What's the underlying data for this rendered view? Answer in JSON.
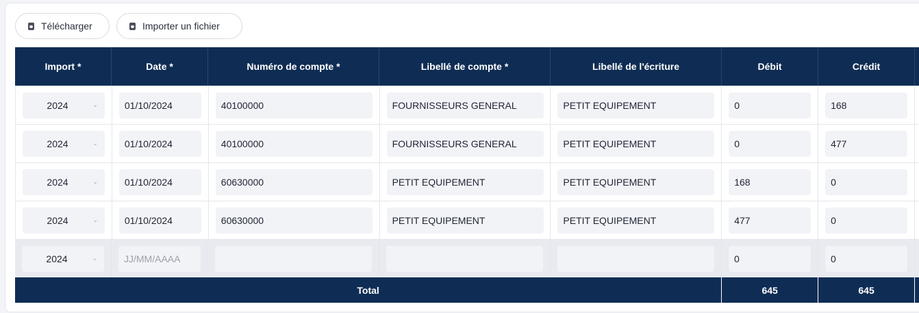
{
  "toolbar": {
    "download_label": "Télécharger",
    "import_label": "Importer un fichier",
    "download_icon": "file-download-icon",
    "import_icon": "file-import-icon"
  },
  "table": {
    "headers": [
      "Import *",
      "Date *",
      "Numéro de compte *",
      "Libellé de compte *",
      "Libellé de l'écriture",
      "Débit",
      "Crédit"
    ],
    "rows": [
      {
        "import": "2024",
        "date": "01/10/2024",
        "account_number": "40100000",
        "account_label": "FOURNISSEURS GENERAL",
        "entry_label": "PETIT EQUIPEMENT",
        "debit": "0",
        "credit": "168"
      },
      {
        "import": "2024",
        "date": "01/10/2024",
        "account_number": "40100000",
        "account_label": "FOURNISSEURS GENERAL",
        "entry_label": "PETIT EQUIPEMENT",
        "debit": "0",
        "credit": "477"
      },
      {
        "import": "2024",
        "date": "01/10/2024",
        "account_number": "60630000",
        "account_label": "PETIT EQUIPEMENT",
        "entry_label": "PETIT EQUIPEMENT",
        "debit": "168",
        "credit": "0"
      },
      {
        "import": "2024",
        "date": "01/10/2024",
        "account_number": "60630000",
        "account_label": "PETIT EQUIPEMENT",
        "entry_label": "PETIT EQUIPEMENT",
        "debit": "477",
        "credit": "0"
      }
    ],
    "new_row": {
      "import": "2024",
      "date_placeholder": "JJ/MM/AAAA",
      "account_number": "",
      "account_label": "",
      "entry_label": "",
      "debit": "0",
      "credit": "0"
    },
    "total": {
      "label": "Total",
      "debit": "645",
      "credit": "645"
    },
    "chevron": "⌄"
  },
  "colors": {
    "header_bg": "#0f2d54",
    "field_bg": "#f2f3f7"
  }
}
